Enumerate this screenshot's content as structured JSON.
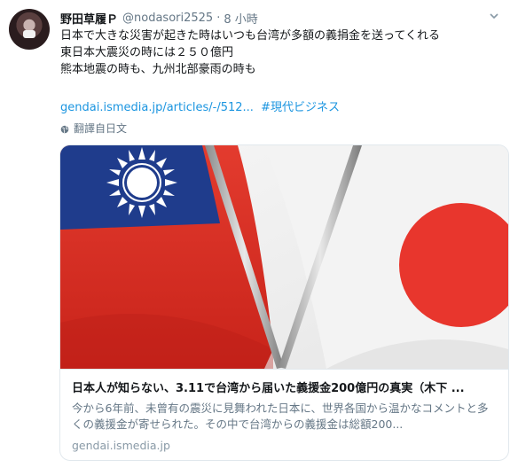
{
  "user": {
    "display_name": "野田草履Ｐ",
    "handle": "@nodasori2525",
    "separator": "·",
    "time": "8 小時"
  },
  "tweet": {
    "lines": [
      "日本で大きな災害が起きた時はいつも台湾が多額の義捐金を送ってくれる",
      "東日本大震災の時には２５０億円",
      "熊本地震の時も、九州北部豪雨の時も"
    ],
    "link_text": "gendai.ismedia.jp/articles/-/512...",
    "hashtag": "#現代ビジネス"
  },
  "translate_label": "翻譯自日文",
  "card": {
    "title": "日本人が知らない、3.11で台湾から届いた義援金200億円の真実（木下 ...",
    "description": "今から6年前、未曾有の震災に見舞われた日本に、世界各国から温かなコメントと多くの義援金が寄せられた。その中で台湾からの義援金は総額200...",
    "domain": "gendai.ismedia.jp"
  },
  "icons": {
    "avatar": "avatar",
    "globe": "globe-icon",
    "menu": "chevron-down-icon"
  },
  "colors": {
    "link": "#1b95e0",
    "secondary_text": "#657786",
    "taiwan_red": "#e2231a",
    "taiwan_blue": "#1a3a8a",
    "japan_red": "#e8362d"
  }
}
